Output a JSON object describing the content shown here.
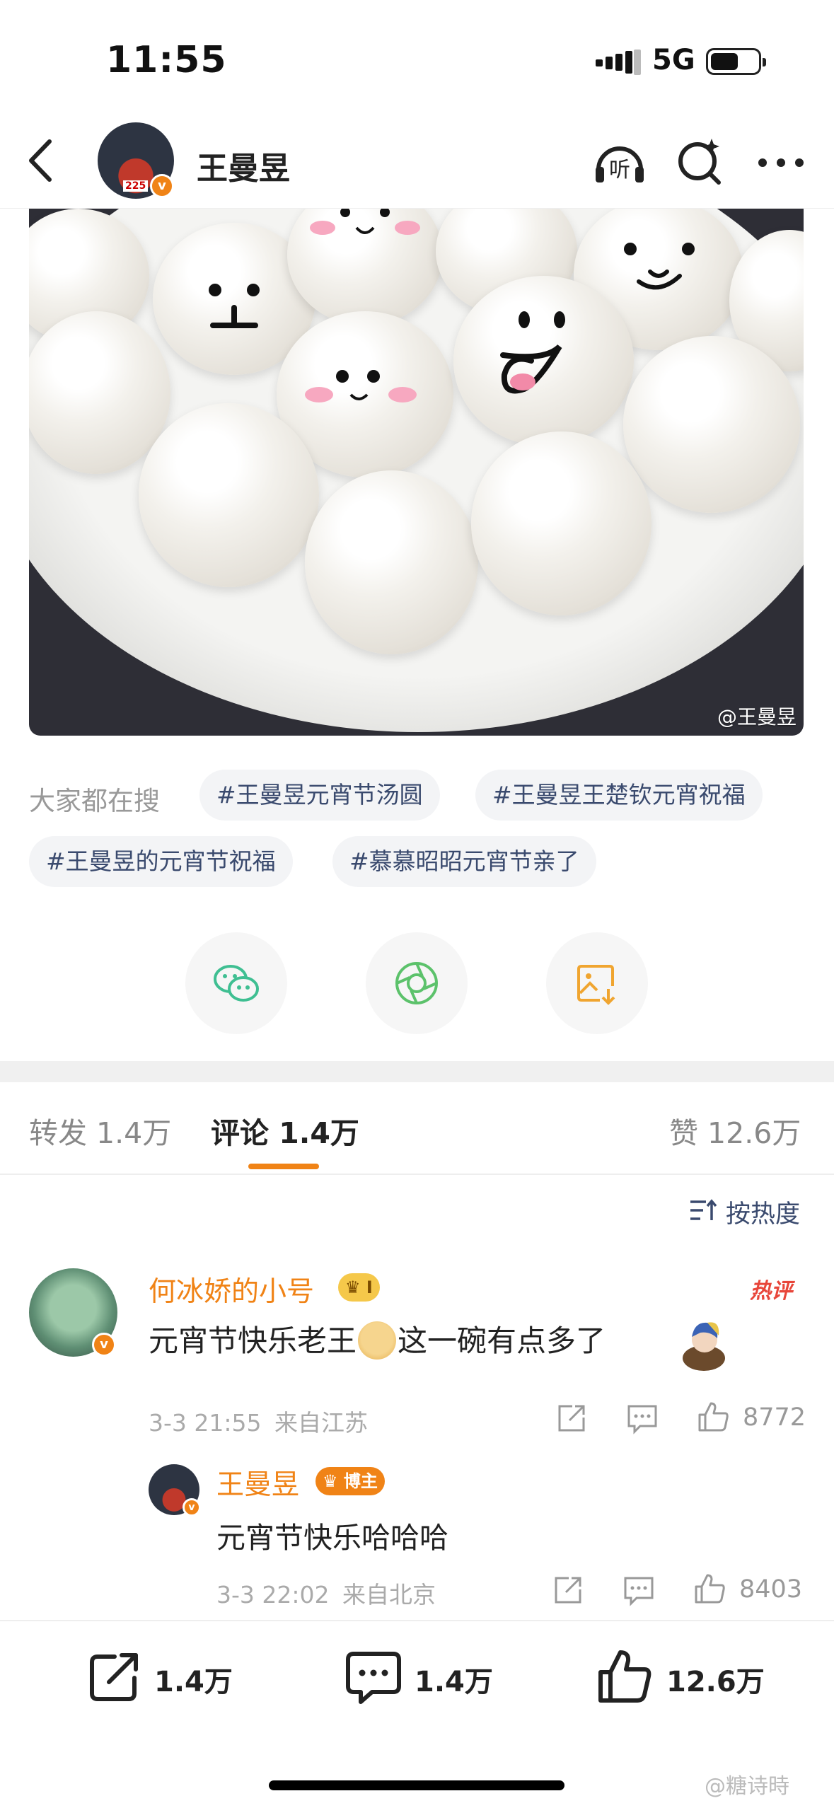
{
  "status_bar": {
    "time": "11:55",
    "network": "5G"
  },
  "nav": {
    "title": "王曼昱",
    "avatar_number": "225",
    "listen_label": "听"
  },
  "photo": {
    "watermark": "@王曼昱"
  },
  "hot_search": {
    "label": "大家都在搜",
    "tags": [
      "#王曼昱元宵节汤圆",
      "#王曼昱王楚钦元宵祝福",
      "#王曼昱的元宵节祝福",
      "#慕慕昭昭元宵节亲了"
    ]
  },
  "tabs": [
    {
      "label": "转发",
      "count": "1.4万"
    },
    {
      "label": "评论",
      "count": "1.4万"
    },
    {
      "label": "赞",
      "count": "12.6万"
    }
  ],
  "sort_label": "按热度",
  "comment": {
    "user": "何冰娇的小号",
    "vip_level": "I",
    "hot_tag": "热评",
    "text_before_emoji": "元宵节快乐老王",
    "text_after_emoji": "这一碗有点多了",
    "time": "3-3 21:55",
    "location": "来自江苏",
    "likes": "8772",
    "reply": {
      "user": "王曼昱",
      "badge": "博主",
      "text": "元宵节快乐哈哈哈",
      "time": "3-3 22:02",
      "location": "来自北京",
      "likes": "8403"
    }
  },
  "bottom_bar": {
    "reposts": "1.4万",
    "comments": "1.4万",
    "likes": "12.6万"
  },
  "page_watermark": "@糖诗時",
  "colors": {
    "accent": "#f08316",
    "tag_text": "#3a4a6e",
    "hot_red": "#e8463a"
  }
}
